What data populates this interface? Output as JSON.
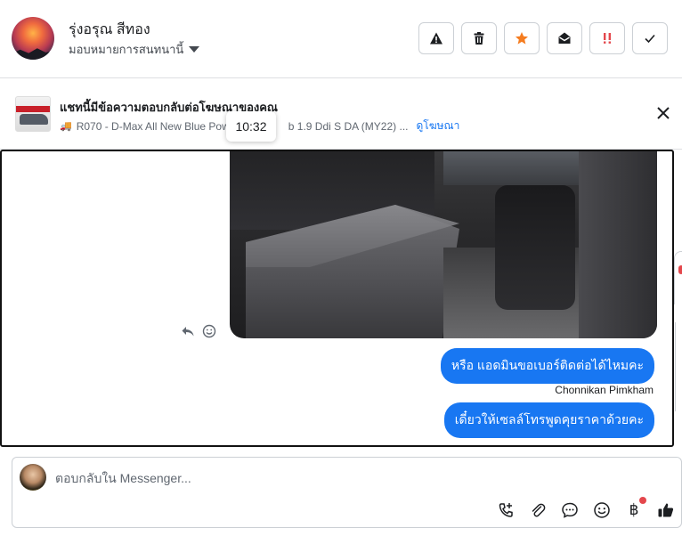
{
  "header": {
    "contact_name": "รุ่งอรุณ สีทอง",
    "assign_label": "มอบหมายการสนทนานี้",
    "actions": [
      {
        "name": "report-spam-button",
        "icon": "warning-icon"
      },
      {
        "name": "delete-button",
        "icon": "trash-icon"
      },
      {
        "name": "star-button",
        "icon": "star-icon",
        "color": "#f57c1f"
      },
      {
        "name": "mark-unread-button",
        "icon": "open-envelope-icon"
      },
      {
        "name": "follow-up-button",
        "icon": "priority-icon",
        "color": "#e4474c"
      },
      {
        "name": "mark-done-button",
        "icon": "check-icon"
      }
    ]
  },
  "ad": {
    "title": "แชทนี้มีข้อความตอบกลับต่อโฆษณาของคุณ",
    "subtitle": "R070 - D-Max All New Blue Pow",
    "subtitle_rest": "b 1.9 Ddi S DA (MY22) ...",
    "link": "ดูโฆษณา"
  },
  "tooltip": "10:32",
  "messages": [
    {
      "type": "image",
      "alt": "car interior rear bench seat"
    },
    {
      "type": "text",
      "text": "หรือ แอดมินขอเบอร์ติดต่อได้ไหมคะ"
    },
    {
      "type": "sender",
      "text": "Chonnikan Pimkham"
    },
    {
      "type": "text",
      "text": "เดี๋ยวให้เซลล์โทรพูดคุยราคาด้วยคะ"
    }
  ],
  "composer": {
    "placeholder": "ตอบกลับใน Messenger...",
    "value": ""
  },
  "colors": {
    "accent": "#1877f2",
    "star": "#f57c1f",
    "alert": "#e4474c"
  }
}
